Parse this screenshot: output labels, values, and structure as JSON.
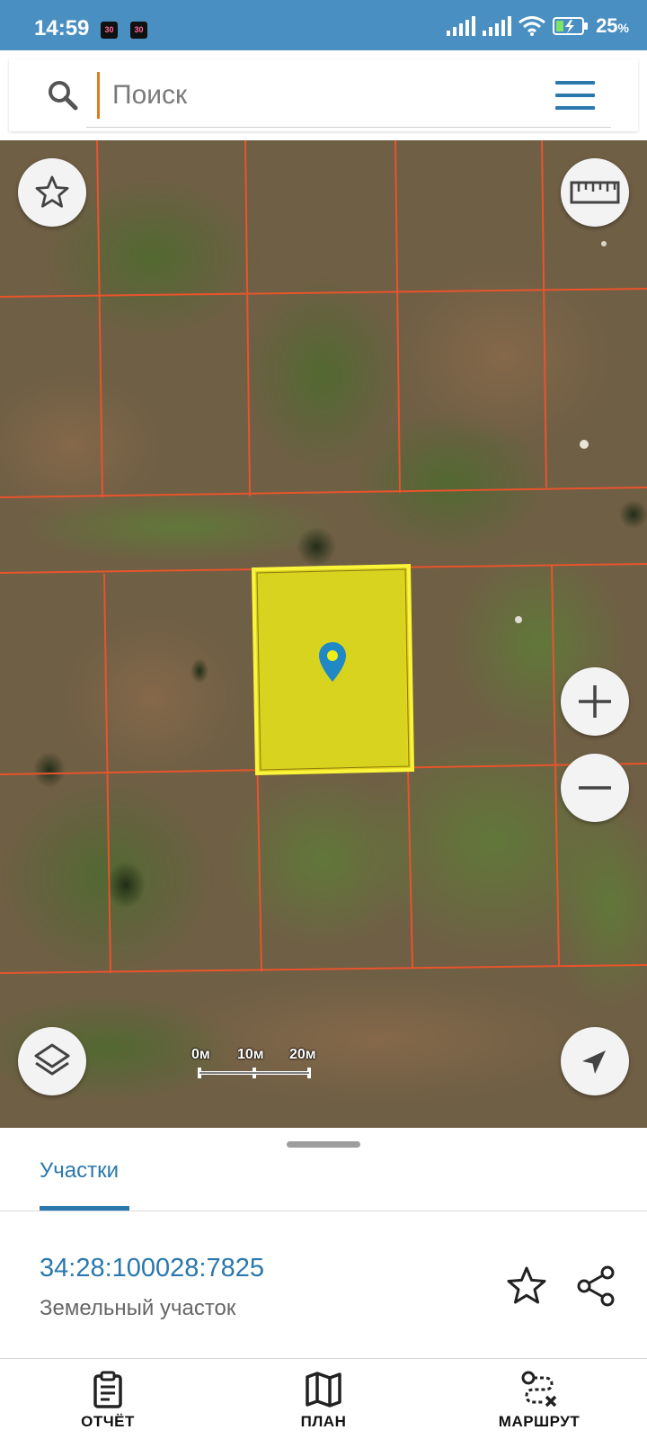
{
  "status_bar": {
    "time": "14:59",
    "badges": [
      "30",
      "30"
    ],
    "battery": "25",
    "battery_unit": "%"
  },
  "search": {
    "placeholder": "Поиск",
    "value": ""
  },
  "map": {
    "scale_labels": [
      "0м",
      "10м",
      "20м"
    ],
    "selected_parcel_color": "#f2ee18",
    "boundary_color": "#e8542c"
  },
  "sheet": {
    "tab_label": "Участки",
    "parcel_number": "34:28:100028:7825",
    "parcel_type": "Земельный участок"
  },
  "bottom_nav": {
    "items": [
      {
        "label": "ОТЧЁТ",
        "icon": "clipboard-icon"
      },
      {
        "label": "ПЛАН",
        "icon": "map-icon"
      },
      {
        "label": "МАРШРУТ",
        "icon": "route-icon"
      }
    ]
  },
  "colors": {
    "accent": "#2a78ad",
    "status_bar": "#4a8fc2",
    "cursor": "#e07b1a"
  }
}
